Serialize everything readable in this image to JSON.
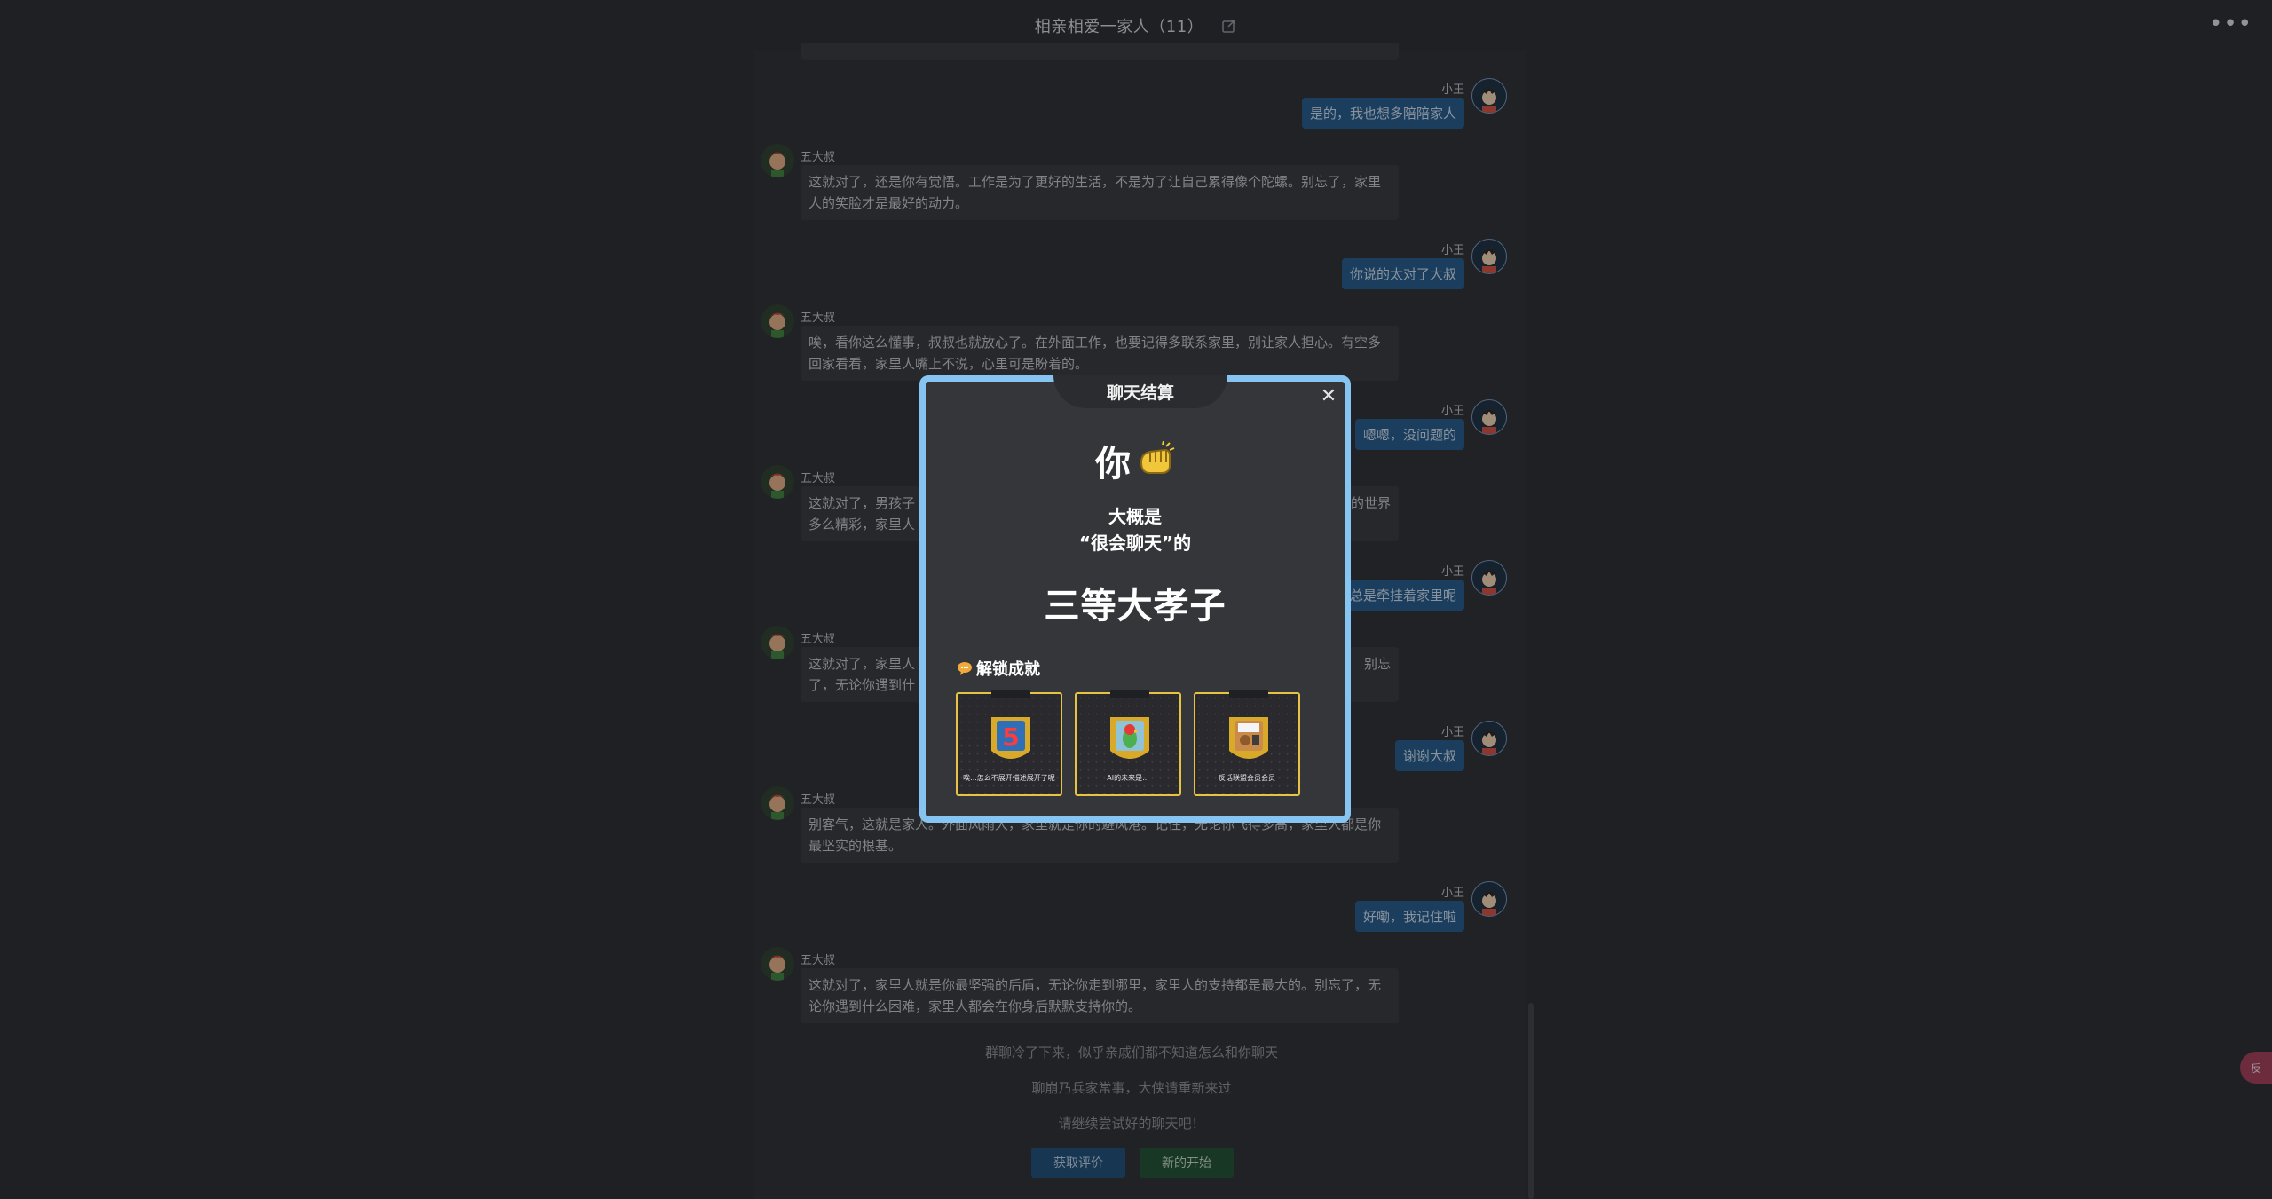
{
  "header": {
    "title": "相亲相爱一家人（11）"
  },
  "messages": [
    {
      "side": "right",
      "sender": "小王",
      "text": "是的，我也想多陪陪家人"
    },
    {
      "side": "left",
      "sender": "五大叔",
      "text": "这就对了，还是你有觉悟。工作是为了更好的生活，不是为了让自己累得像个陀螺。别忘了，家里人的笑脸才是最好的动力。"
    },
    {
      "side": "right",
      "sender": "小王",
      "text": "你说的太对了大叔"
    },
    {
      "side": "left",
      "sender": "五大叔",
      "text": "唉，看你这么懂事，叔叔也就放心了。在外面工作，也要记得多联系家里，别让家人担心。有空多回家看看，家里人嘴上不说，心里可是盼着的。"
    },
    {
      "side": "right",
      "sender": "小王",
      "text": "嗯嗯，没问题的"
    },
    {
      "side": "left",
      "sender": "五大叔",
      "text_a": "这就对了，男孩子",
      "text_b": "的世界",
      "text_c": "多么精彩，家里人"
    },
    {
      "side": "right",
      "sender": "小王",
      "text": "总是牵挂着家里呢"
    },
    {
      "side": "left",
      "sender": "五大叔",
      "text_a": "这就对了，家里人",
      "text_b": "别忘",
      "text_c": "了，无论你遇到什"
    },
    {
      "side": "right",
      "sender": "小王",
      "text": "谢谢大叔"
    },
    {
      "side": "left",
      "sender": "五大叔",
      "text": "别客气，这就是家人。外面风雨大，家里就是你的避风港。记住，无论你飞得多高，家里人都是你最坚实的根基。"
    },
    {
      "side": "right",
      "sender": "小王",
      "text": "好嘞，我记住啦"
    },
    {
      "side": "left",
      "sender": "五大叔",
      "text": "这就对了，家里人就是你最坚强的后盾，无论你走到哪里，家里人的支持都是最大的。别忘了，无论你遇到什么困难，家里人都会在你身后默默支持你的。"
    }
  ],
  "system": {
    "line1": "群聊冷了下来，似乎亲戚们都不知道怎么和你聊天",
    "line2": "聊崩乃兵家常事，大侠请重新来过",
    "line3": "请继续尝试好的聊天吧！"
  },
  "buttons": {
    "evaluate": "获取评价",
    "restart": "新的开始"
  },
  "side_tab": "反",
  "modal": {
    "tab_title": "聊天结算",
    "you": "你",
    "line1": "大概是",
    "line2": "“很会聊天”的",
    "rank": "三等大孝子",
    "achievements_title": "解锁成就",
    "badges": [
      {
        "name": "唉...怎么不展开描述展开了呢",
        "icon": "number-5-icon"
      },
      {
        "name": "AI的未来是...",
        "icon": "parrot-icon"
      },
      {
        "name": "反话联盟会员会员",
        "icon": "certificate-icon"
      }
    ]
  },
  "colors": {
    "modal_border": "#86c5f2",
    "badge_border": "#e8c242",
    "right_bubble": "#215482",
    "evaluate_button": "#1b4870",
    "restart_button": "#1f4a2d"
  }
}
